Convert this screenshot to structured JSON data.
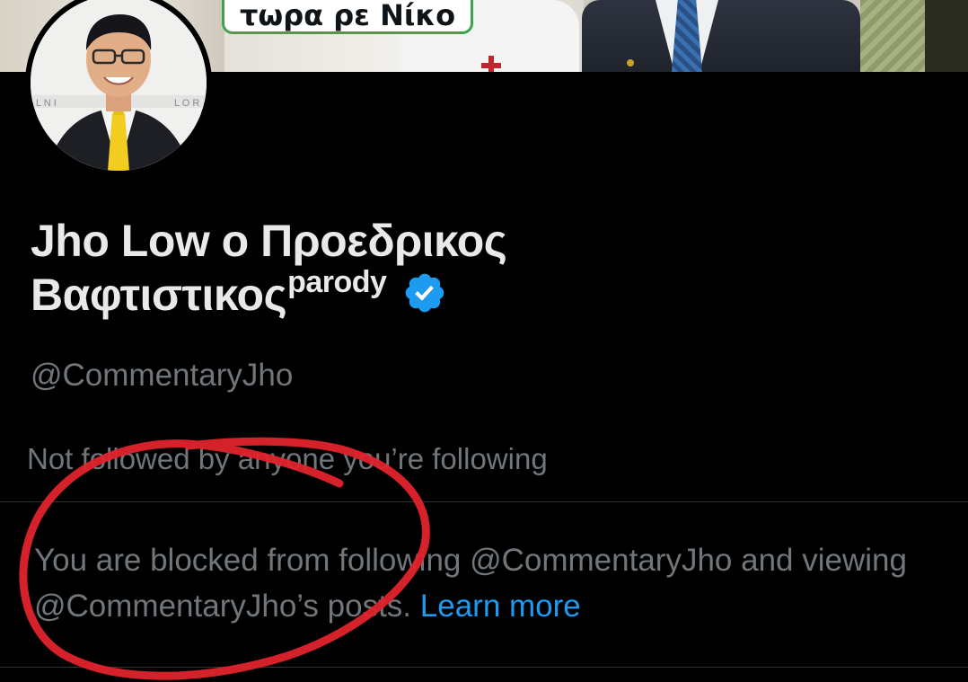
{
  "banner": {
    "caption": "τωρα ρε Νίκο"
  },
  "profile": {
    "display_name_line1": "Jho Low ο Προεδρικος",
    "display_name_line2": "Βαφτιστικος",
    "display_name_superscript": "parody",
    "handle": "@CommentaryJho",
    "followers_note": "Not followed by anyone you’re following",
    "verified": true
  },
  "blocked_notice": {
    "text": "You are blocked from following @CommentaryJho and viewing @CommentaryJho’s posts. ",
    "link_label": "Learn more"
  },
  "colors": {
    "background": "#000000",
    "primary_text": "#e7e9ea",
    "secondary_text": "#71767b",
    "link": "#1d9bf0",
    "verified_badge": "#1d9bf0",
    "divider": "#2f3336",
    "annotation": "#e0232b",
    "caption_border": "#3fa34d"
  },
  "icons": {
    "verified": "verified-badge-icon"
  }
}
